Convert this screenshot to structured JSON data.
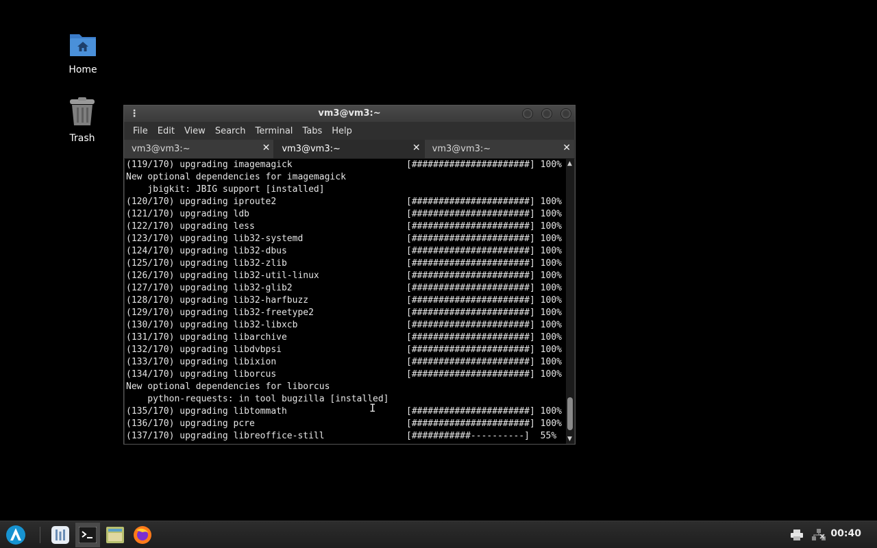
{
  "desktop": {
    "icons": [
      {
        "label": "Home"
      },
      {
        "label": "Trash"
      }
    ]
  },
  "window": {
    "title": "vm3@vm3:~",
    "menu": [
      "File",
      "Edit",
      "View",
      "Search",
      "Terminal",
      "Tabs",
      "Help"
    ],
    "tabs": [
      {
        "label": "vm3@vm3:~"
      },
      {
        "label": "vm3@vm3:~"
      },
      {
        "label": "vm3@vm3:~"
      }
    ],
    "active_tab": 1
  },
  "terminal": {
    "lines": [
      {
        "text": "(119/170) upgrading imagemagick",
        "bar": "[######################] 100%"
      },
      {
        "text": "New optional dependencies for imagemagick",
        "bar": ""
      },
      {
        "text": "    jbigkit: JBIG support [installed]",
        "bar": ""
      },
      {
        "text": "(120/170) upgrading iproute2",
        "bar": "[######################] 100%"
      },
      {
        "text": "(121/170) upgrading ldb",
        "bar": "[######################] 100%"
      },
      {
        "text": "(122/170) upgrading less",
        "bar": "[######################] 100%"
      },
      {
        "text": "(123/170) upgrading lib32-systemd",
        "bar": "[######################] 100%"
      },
      {
        "text": "(124/170) upgrading lib32-dbus",
        "bar": "[######################] 100%"
      },
      {
        "text": "(125/170) upgrading lib32-zlib",
        "bar": "[######################] 100%"
      },
      {
        "text": "(126/170) upgrading lib32-util-linux",
        "bar": "[######################] 100%"
      },
      {
        "text": "(127/170) upgrading lib32-glib2",
        "bar": "[######################] 100%"
      },
      {
        "text": "(128/170) upgrading lib32-harfbuzz",
        "bar": "[######################] 100%"
      },
      {
        "text": "(129/170) upgrading lib32-freetype2",
        "bar": "[######################] 100%"
      },
      {
        "text": "(130/170) upgrading lib32-libxcb",
        "bar": "[######################] 100%"
      },
      {
        "text": "(131/170) upgrading libarchive",
        "bar": "[######################] 100%"
      },
      {
        "text": "(132/170) upgrading libdvbpsi",
        "bar": "[######################] 100%"
      },
      {
        "text": "(133/170) upgrading libixion",
        "bar": "[######################] 100%"
      },
      {
        "text": "(134/170) upgrading liborcus",
        "bar": "[######################] 100%"
      },
      {
        "text": "New optional dependencies for liborcus",
        "bar": ""
      },
      {
        "text": "    python-requests: in tool bugzilla [installed]",
        "bar": ""
      },
      {
        "text": "(135/170) upgrading libtommath",
        "bar": "[######################] 100%"
      },
      {
        "text": "(136/170) upgrading pcre",
        "bar": "[######################] 100%"
      },
      {
        "text": "(137/170) upgrading libreoffice-still",
        "bar": "[###########----------]  55%"
      }
    ]
  },
  "taskbar": {
    "apps": [
      "start-menu-icon",
      "app-grid-icon",
      "terminal-icon",
      "file-manager-icon",
      "firefox-icon"
    ],
    "active_app": "terminal-icon",
    "clock": "00:40"
  },
  "colors": {
    "desktop_bg": "#000000",
    "folder_blue": "#4a90d9",
    "start_blue": "#1793d1"
  }
}
